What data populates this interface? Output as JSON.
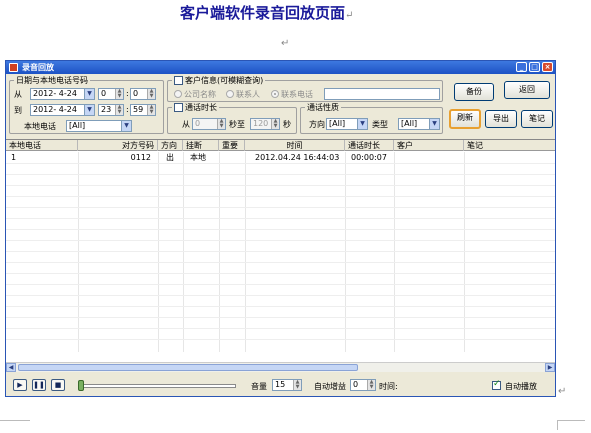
{
  "document": {
    "heading": "客户端软件录音回放页面"
  },
  "window": {
    "title": "录音回放"
  },
  "filters": {
    "date_group_label": "日期与本地电话号码",
    "from_label": "从",
    "from_date": "2012- 4-24",
    "from_hour": "0",
    "from_minute": "0",
    "to_label": "到",
    "to_date": "2012- 4-24",
    "to_hour": "23",
    "to_minute": "59",
    "local_phone_label": "本地电话",
    "local_phone_value": "[All]",
    "time_sep": ":"
  },
  "customer": {
    "group_label": "客户信息(可模糊查询)",
    "enabled": false,
    "options": [
      "公司名称",
      "联系人",
      "联系电话"
    ],
    "selected_option": "联系电话",
    "query_value": ""
  },
  "duration": {
    "group_label": "通话时长",
    "enabled": false,
    "from_label": "从",
    "from_value": "0",
    "to_label": "秒至",
    "to_value": "120",
    "unit_label": "秒"
  },
  "call_nature": {
    "group_label": "通话性质",
    "direction_label": "方向",
    "direction_value": "[All]",
    "type_label": "类型",
    "type_value": "[All]"
  },
  "buttons": {
    "backup": "备份",
    "back": "返回",
    "refresh": "刷新",
    "export": "导出",
    "notes": "笔记"
  },
  "table": {
    "columns": [
      "本地电话",
      "对方号码",
      "方向",
      "挂断",
      "重要",
      "时间",
      "通话时长",
      "客户",
      "笔记"
    ],
    "rows": [
      {
        "local_phone": "1",
        "remote_number": "0112",
        "direction": "出",
        "hangup": "本地",
        "important": "",
        "time": "2012.04.24 16:44:03",
        "duration": "00:00:07",
        "customer": "",
        "notes": ""
      }
    ]
  },
  "player": {
    "play_icon": "play-icon",
    "pause_icon": "pause-icon",
    "stop_icon": "stop-icon",
    "progress": 0,
    "volume_label": "音量",
    "volume_value": "15",
    "auto_gain_label": "自动增益",
    "auto_gain_value": "0",
    "time_label": "时间:",
    "auto_play_label": "自动播放",
    "auto_play_checked": true
  },
  "colors": {
    "titlebar": "#1d52c4",
    "heading": "#1a1a9a",
    "focus_border": "#e8a030"
  }
}
